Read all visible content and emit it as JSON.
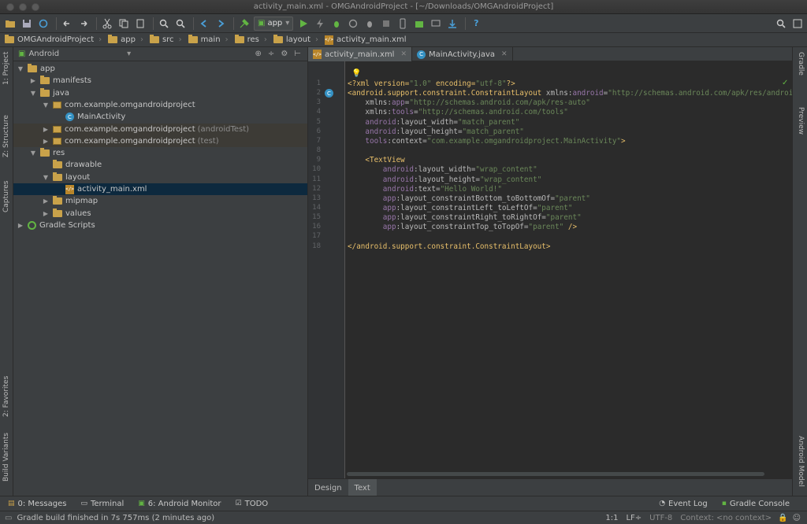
{
  "window": {
    "title": "activity_main.xml - OMGAndroidProject - [~/Downloads/OMGAndroidProject]"
  },
  "toolbar": {
    "run_config": "app"
  },
  "breadcrumbs": [
    "OMGAndroidProject",
    "app",
    "src",
    "main",
    "res",
    "layout",
    "activity_main.xml"
  ],
  "side_tabs_left": {
    "project": "1: Project",
    "structure": "Z: Structure",
    "captures": "Captures",
    "favorites": "2: Favorites",
    "build_variants": "Build Variants"
  },
  "side_tabs_right": {
    "gradle": "Gradle",
    "preview": "Preview",
    "android_model": "Android Model"
  },
  "project_panel": {
    "view_selector": "Android",
    "tree": [
      {
        "label": "app",
        "extra": "",
        "indent": 0,
        "arrow": "▼",
        "icon": "folder"
      },
      {
        "label": "manifests",
        "extra": "",
        "indent": 1,
        "arrow": "▶",
        "icon": "folder"
      },
      {
        "label": "java",
        "extra": "",
        "indent": 1,
        "arrow": "▼",
        "icon": "folder"
      },
      {
        "label": "com.example.omgandroidproject",
        "extra": "",
        "indent": 2,
        "arrow": "▼",
        "icon": "package"
      },
      {
        "label": "MainActivity",
        "extra": "",
        "indent": 3,
        "arrow": "",
        "icon": "class"
      },
      {
        "label": "com.example.omgandroidproject",
        "extra": "(androidTest)",
        "indent": 2,
        "arrow": "▶",
        "icon": "package"
      },
      {
        "label": "com.example.omgandroidproject",
        "extra": "(test)",
        "indent": 2,
        "arrow": "▶",
        "icon": "package"
      },
      {
        "label": "res",
        "extra": "",
        "indent": 1,
        "arrow": "▼",
        "icon": "folder"
      },
      {
        "label": "drawable",
        "extra": "",
        "indent": 2,
        "arrow": "",
        "icon": "folder"
      },
      {
        "label": "layout",
        "extra": "",
        "indent": 2,
        "arrow": "▼",
        "icon": "folder"
      },
      {
        "label": "activity_main.xml",
        "extra": "",
        "indent": 3,
        "arrow": "",
        "icon": "xml"
      },
      {
        "label": "mipmap",
        "extra": "",
        "indent": 2,
        "arrow": "▶",
        "icon": "folder"
      },
      {
        "label": "values",
        "extra": "",
        "indent": 2,
        "arrow": "▶",
        "icon": "folder"
      },
      {
        "label": "Gradle Scripts",
        "extra": "",
        "indent": 0,
        "arrow": "▶",
        "icon": "gradle"
      }
    ]
  },
  "editor": {
    "tabs": [
      {
        "label": "activity_main.xml",
        "icon": "xml"
      },
      {
        "label": "MainActivity.java",
        "icon": "class"
      }
    ],
    "lines": [
      [
        [
          "tag",
          "<?xml version="
        ],
        [
          "val",
          "\"1.0\""
        ],
        [
          "tag",
          " encoding="
        ],
        [
          "val",
          "\"utf-8\""
        ],
        [
          "tag",
          "?>"
        ]
      ],
      [
        [
          "tag",
          "<android.support.constraint.ConstraintLayout "
        ],
        [
          "attr",
          "xmlns:"
        ],
        [
          "ns",
          "android"
        ],
        [
          "attr",
          "="
        ],
        [
          "val",
          "\"http://schemas.android.com/apk/res/android\""
        ]
      ],
      [
        [
          "attr",
          "    xmlns:"
        ],
        [
          "ns",
          "app"
        ],
        [
          "attr",
          "="
        ],
        [
          "val",
          "\"http://schemas.android.com/apk/res-auto\""
        ]
      ],
      [
        [
          "attr",
          "    xmlns:"
        ],
        [
          "ns",
          "tools"
        ],
        [
          "attr",
          "="
        ],
        [
          "val",
          "\"http://schemas.android.com/tools\""
        ]
      ],
      [
        [
          "ns",
          "    android"
        ],
        [
          "attr",
          ":layout_width="
        ],
        [
          "val",
          "\"match_parent\""
        ]
      ],
      [
        [
          "ns",
          "    android"
        ],
        [
          "attr",
          ":layout_height="
        ],
        [
          "val",
          "\"match_parent\""
        ]
      ],
      [
        [
          "ns",
          "    tools"
        ],
        [
          "attr",
          ":context="
        ],
        [
          "val",
          "\"com.example.omgandroidproject.MainActivity\""
        ],
        [
          "tag",
          ">"
        ]
      ],
      [
        [
          "pl",
          ""
        ]
      ],
      [
        [
          "tag",
          "    <TextView"
        ]
      ],
      [
        [
          "ns",
          "        android"
        ],
        [
          "attr",
          ":layout_width="
        ],
        [
          "val",
          "\"wrap_content\""
        ]
      ],
      [
        [
          "ns",
          "        android"
        ],
        [
          "attr",
          ":layout_height="
        ],
        [
          "val",
          "\"wrap_content\""
        ]
      ],
      [
        [
          "ns",
          "        android"
        ],
        [
          "attr",
          ":text="
        ],
        [
          "val",
          "\"Hello World!\""
        ]
      ],
      [
        [
          "ns",
          "        app"
        ],
        [
          "attr",
          ":layout_constraintBottom_toBottomOf="
        ],
        [
          "val",
          "\"parent\""
        ]
      ],
      [
        [
          "ns",
          "        app"
        ],
        [
          "attr",
          ":layout_constraintLeft_toLeftOf="
        ],
        [
          "val",
          "\"parent\""
        ]
      ],
      [
        [
          "ns",
          "        app"
        ],
        [
          "attr",
          ":layout_constraintRight_toRightOf="
        ],
        [
          "val",
          "\"parent\""
        ]
      ],
      [
        [
          "ns",
          "        app"
        ],
        [
          "attr",
          ":layout_constraintTop_toTopOf="
        ],
        [
          "val",
          "\"parent\""
        ],
        [
          "tag",
          " />"
        ]
      ],
      [
        [
          "pl",
          ""
        ]
      ],
      [
        [
          "tag",
          "</android.support.constraint.ConstraintLayout>"
        ]
      ]
    ],
    "line_numbers": [
      "1",
      "2",
      "3",
      "4",
      "5",
      "6",
      "7",
      "8",
      "9",
      "10",
      "11",
      "12",
      "13",
      "14",
      "15",
      "16",
      "17",
      "18"
    ],
    "mode_tabs": [
      "Design",
      "Text"
    ]
  },
  "tool_windows": {
    "messages": "0: Messages",
    "terminal": "Terminal",
    "android_monitor": "6: Android Monitor",
    "todo": "TODO",
    "event_log": "Event Log",
    "gradle_console": "Gradle Console"
  },
  "status": {
    "message": "Gradle build finished in 7s 757ms (2 minutes ago)",
    "position": "1:1",
    "line_sep": "LF÷",
    "encoding": "UTF-8",
    "context": "Context: <no context>"
  },
  "colors": {
    "tag": "#e8bf6a",
    "namespace": "#9876aa",
    "value": "#6a8759",
    "selection": "#0d293e"
  }
}
